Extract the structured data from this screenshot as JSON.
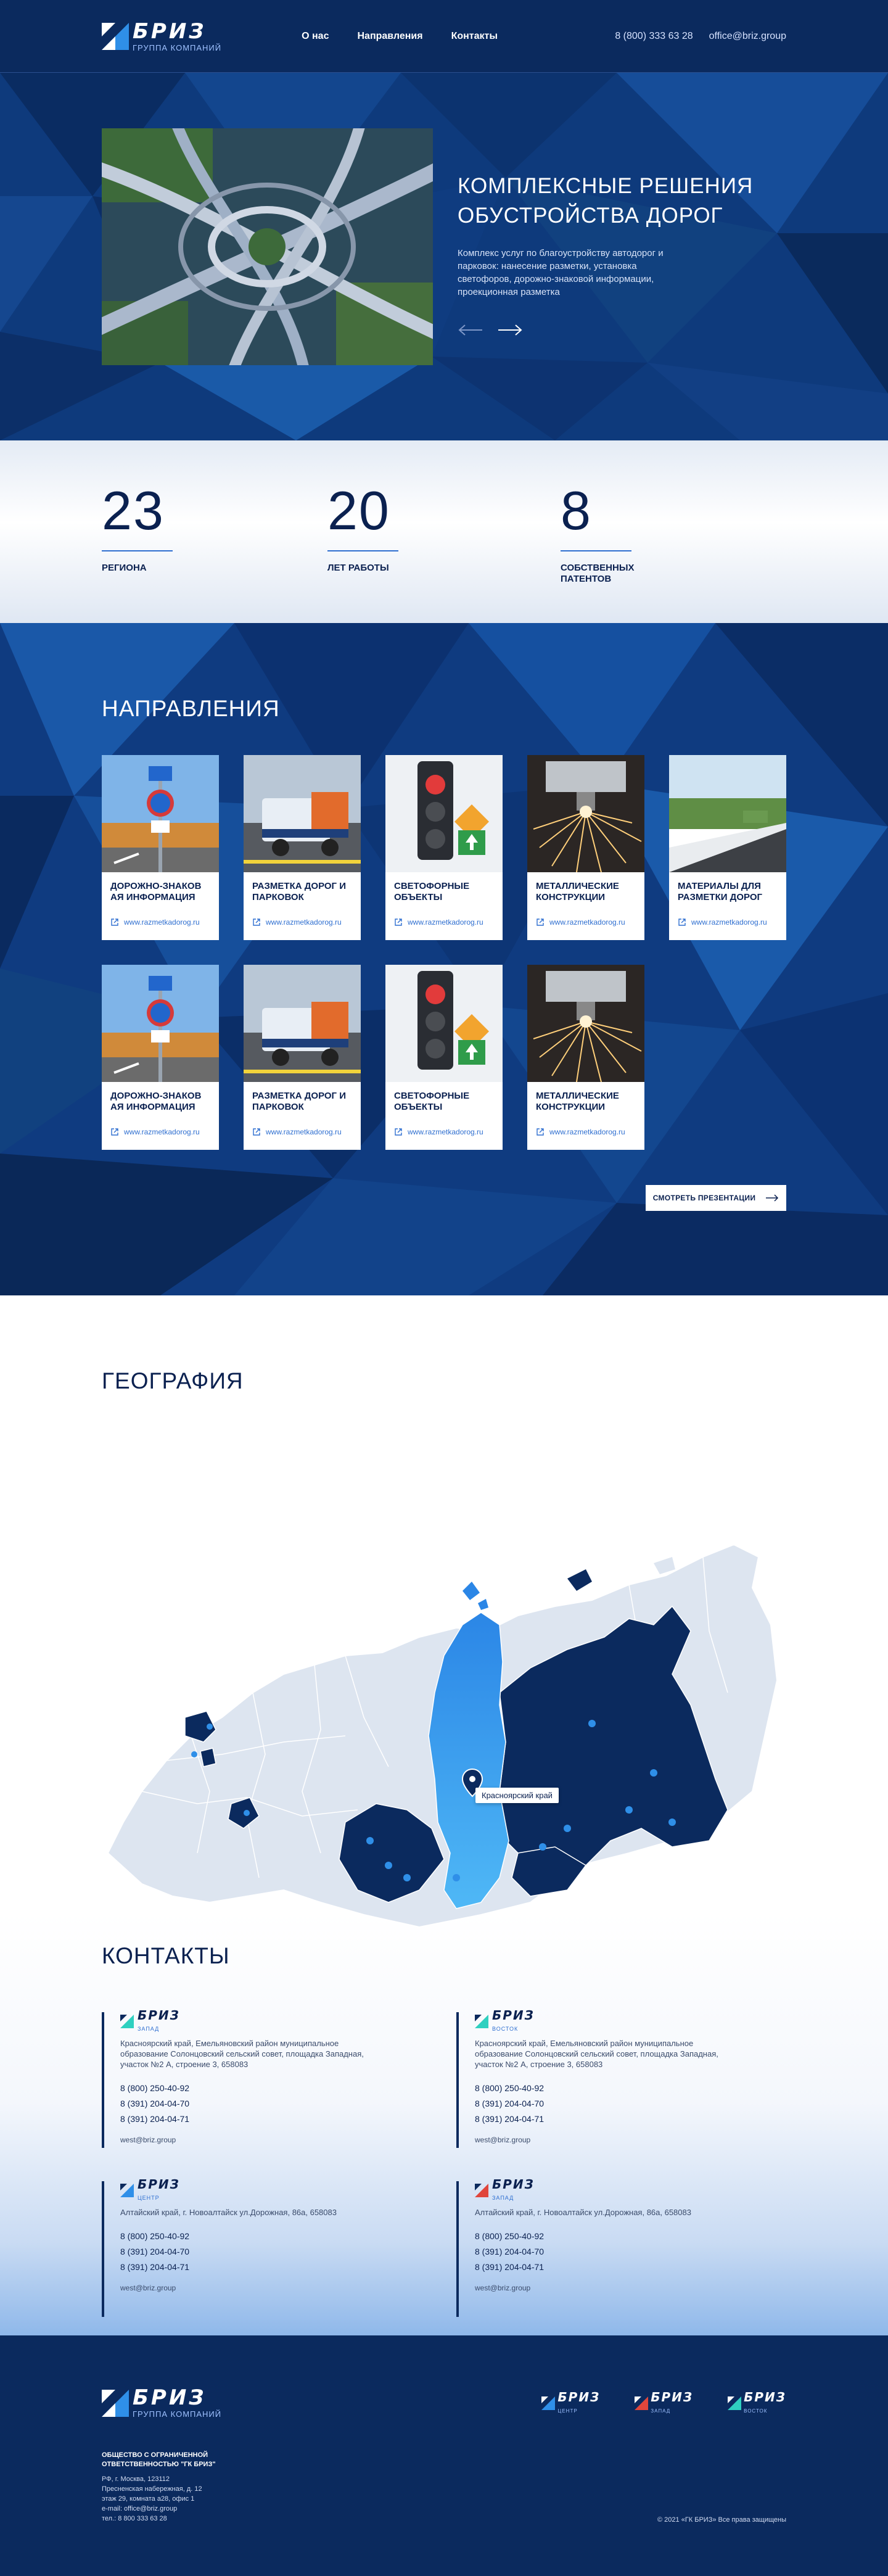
{
  "header": {
    "logo_title": "БРИЗ",
    "logo_sub": "ГРУППА КОМПАНИЙ",
    "nav": [
      "О нас",
      "Направления",
      "Контакты"
    ],
    "phone": "8 (800) 333 63 28",
    "email": "office@briz.group"
  },
  "hero": {
    "title": "КОМПЛЕКСНЫЕ РЕШЕНИЯ ОБУСТРОЙСТВА ДОРОГ",
    "description": "Комплекс услуг по благоустройству автодорог и парковок: нанесение разметки, установка светофоров, дорожно-знаковой информации, проекционная разметка",
    "icons": {
      "prev": "arrow-left-icon",
      "next": "arrow-right-icon"
    }
  },
  "stats": [
    {
      "value": "23",
      "label": "РЕГИОНА"
    },
    {
      "value": "20",
      "label": "ЛЕТ РАБОТЫ"
    },
    {
      "value": "8",
      "label": "СОБСТВЕННЫХ ПАТЕНТОВ"
    }
  ],
  "directions": {
    "title": "НАПРАВЛЕНИЯ",
    "cards": [
      {
        "title": "ДОРОЖНО-ЗНАКОВ АЯ ИНФОРМАЦИЯ",
        "link": "www.razmetkadorog.ru",
        "image": "road-signs"
      },
      {
        "title": "РАЗМЕТКА ДОРОГ И ПАРКОВОК",
        "link": "www.razmetkadorog.ru",
        "image": "marking-truck"
      },
      {
        "title": "СВЕТОФОРНЫЕ ОБЪЕКТЫ",
        "link": "www.razmetkadorog.ru",
        "image": "traffic-light"
      },
      {
        "title": "МЕТАЛЛИЧЕСКИЕ КОНСТРУКЦИИ",
        "link": "www.razmetkadorog.ru",
        "image": "metal-sparks"
      },
      {
        "title": "МАТЕРИАЛЫ ДЛЯ РАЗМЕТКИ ДОРОГ",
        "link": "www.razmetkadorog.ru",
        "image": "road-materials"
      },
      {
        "title": "ДОРОЖНО-ЗНАКОВ АЯ ИНФОРМАЦИЯ",
        "link": "www.razmetkadorog.ru",
        "image": "road-signs"
      },
      {
        "title": "РАЗМЕТКА ДОРОГ И ПАРКОВОК",
        "link": "www.razmetkadorog.ru",
        "image": "marking-truck"
      },
      {
        "title": "СВЕТОФОРНЫЕ ОБЪЕКТЫ",
        "link": "www.razmetkadorog.ru",
        "image": "traffic-light"
      },
      {
        "title": "МЕТАЛЛИЧЕСКИЕ КОНСТРУКЦИИ",
        "link": "www.razmetkadorog.ru",
        "image": "metal-sparks"
      }
    ],
    "button": "СМОТРЕТЬ ПРЕЗЕНТАЦИИ"
  },
  "geography": {
    "title": "ГЕОГРАФИЯ",
    "tooltip": "Красноярский край"
  },
  "contacts": {
    "title": "КОНТАКТЫ",
    "blocks": [
      {
        "brand": "БРИЗ",
        "brand_sub": "ЗАПАД",
        "address": "Красноярский край, Емельяновский район муниципальное образование Солонцовский сельский совет, площадка Западная, участок №2 А, строение 3, 658083",
        "phones": [
          "8 (800) 250-40-92",
          "8 (391) 204-04-70",
          "8 (391) 204-04-71"
        ],
        "email": "west@briz.group"
      },
      {
        "brand": "БРИЗ",
        "brand_sub": "ВОСТОК",
        "address": "Красноярский край, Емельяновский район муниципальное образование Солонцовский сельский совет, площадка Западная, участок №2 А, строение 3, 658083",
        "phones": [
          "8 (800) 250-40-92",
          "8 (391) 204-04-70",
          "8 (391) 204-04-71"
        ],
        "email": "west@briz.group"
      },
      {
        "brand": "БРИЗ",
        "brand_sub": "ЦЕНТР",
        "address": "Алтайский край, г. Новоалтайск ул.Дорожная, 86а, 658083",
        "phones": [
          "8 (800) 250-40-92",
          "8 (391) 204-04-70",
          "8 (391) 204-04-71"
        ],
        "email": "west@briz.group"
      },
      {
        "brand": "БРИЗ",
        "brand_sub": "ЗАПАД",
        "address": "Алтайский край, г. Новоалтайск ул.Дорожная, 86а, 658083",
        "phones": [
          "8 (800) 250-40-92",
          "8 (391) 204-04-70",
          "8 (391) 204-04-71"
        ],
        "email": "west@briz.group"
      }
    ]
  },
  "footer": {
    "logo_title": "БРИЗ",
    "logo_sub": "ГРУППА КОМПАНИЙ",
    "brands": [
      {
        "title": "БРИЗ",
        "sub": "ЦЕНТР"
      },
      {
        "title": "БРИЗ",
        "sub": "ЗАПАД"
      },
      {
        "title": "БРИЗ",
        "sub": "ВОСТОК"
      }
    ],
    "company": "ОБЩЕСТВО С ОГРАНИЧЕННОЙ ОТВЕТСТВЕННОСТЬЮ \"ГК БРИЗ\"",
    "address_lines": [
      "РФ, г. Москва, 123112",
      "Пресненская набережная, д. 12",
      "этаж 29, комната а28, офис 1",
      "e-mail: office@briz.group",
      "тел.: 8 800 333 63 28"
    ],
    "copyright": "© 2021 «ГК БРИЗ» Все права защищены"
  },
  "colors": {
    "navy": "#0b2a5e",
    "accent": "#2f6fd0",
    "map_light": "#dde5f0",
    "map_dark": "#0b2a5e",
    "map_highlight": "#2d9cf0"
  }
}
